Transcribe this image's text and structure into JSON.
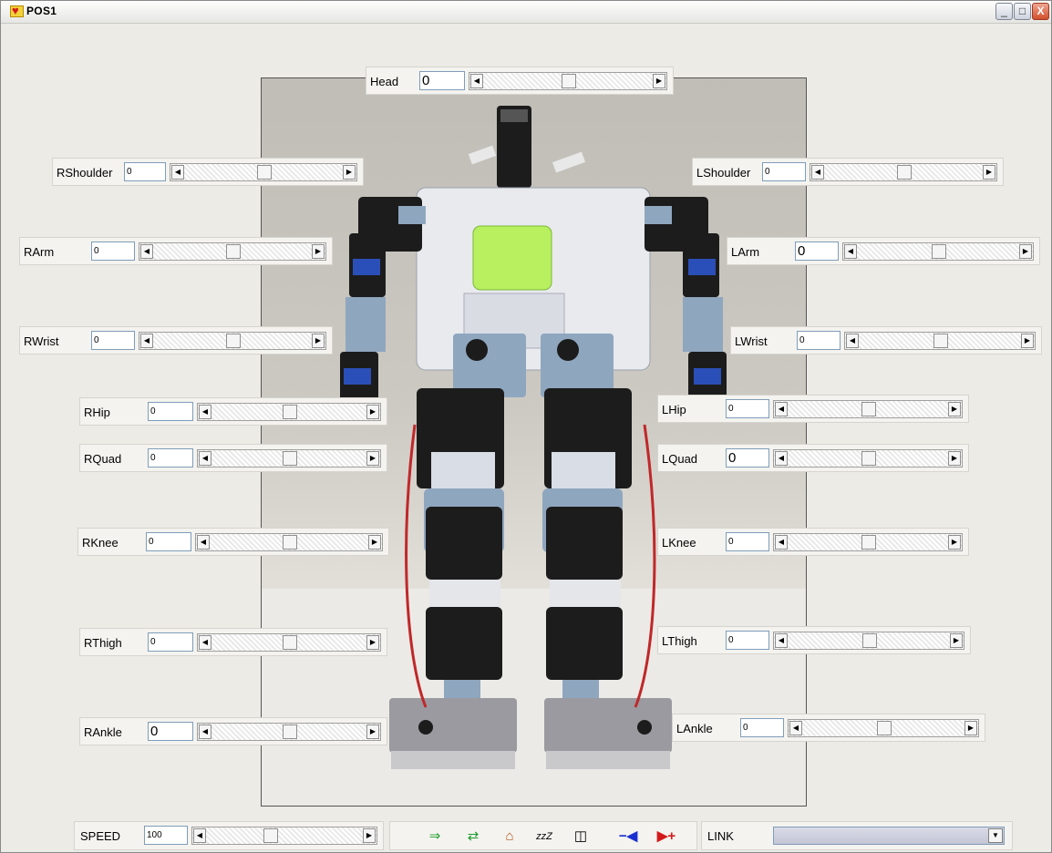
{
  "window": {
    "title": "POS1",
    "minimize": "_",
    "maximize": "□",
    "close": "X"
  },
  "joints": [
    {
      "label": "Head",
      "value": "0",
      "level": 0.5
    },
    {
      "label": "RShoulder",
      "value": "0",
      "level": 0.5
    },
    {
      "label": "LShoulder",
      "value": "0",
      "level": 0.5
    },
    {
      "label": "RArm",
      "value": "0",
      "level": 0.5
    },
    {
      "label": "LArm",
      "value": "0",
      "level": 0.5
    },
    {
      "label": "RWrist",
      "value": "0",
      "level": 0.5
    },
    {
      "label": "LWrist",
      "value": "0",
      "level": 0.5
    },
    {
      "label": "RHip",
      "value": "0",
      "level": 0.5
    },
    {
      "label": "LHip",
      "value": "0",
      "level": 0.5
    },
    {
      "label": "RQuad",
      "value": "0",
      "level": 0.5
    },
    {
      "label": "LQuad",
      "value": "0",
      "level": 0.5
    },
    {
      "label": "RKnee",
      "value": "0",
      "level": 0.5
    },
    {
      "label": "LKnee",
      "value": "0",
      "level": 0.5
    },
    {
      "label": "RThigh",
      "value": "0",
      "level": 0.5
    },
    {
      "label": "LThigh",
      "value": "0",
      "level": 0.5
    },
    {
      "label": "RAnkle",
      "value": "0",
      "level": 0.5
    },
    {
      "label": "LAnkle",
      "value": "0",
      "level": 0.5
    }
  ],
  "speed": {
    "label": "SPEED",
    "value": "100",
    "level": 0.4
  },
  "toolbar": {
    "icons": [
      "monitor-arrow-icon",
      "transfer-icon",
      "home-icon",
      "sleep-icon",
      "camera-icon",
      "minus-arrow-icon",
      "plus-arrow-icon"
    ],
    "sleep_text": "zzZ"
  },
  "link": {
    "label": "LINK",
    "value": ""
  },
  "colors": {
    "accent_blue": "#1a2fd0",
    "accent_red": "#d31a1a",
    "accent_green": "#1f9c2e"
  }
}
